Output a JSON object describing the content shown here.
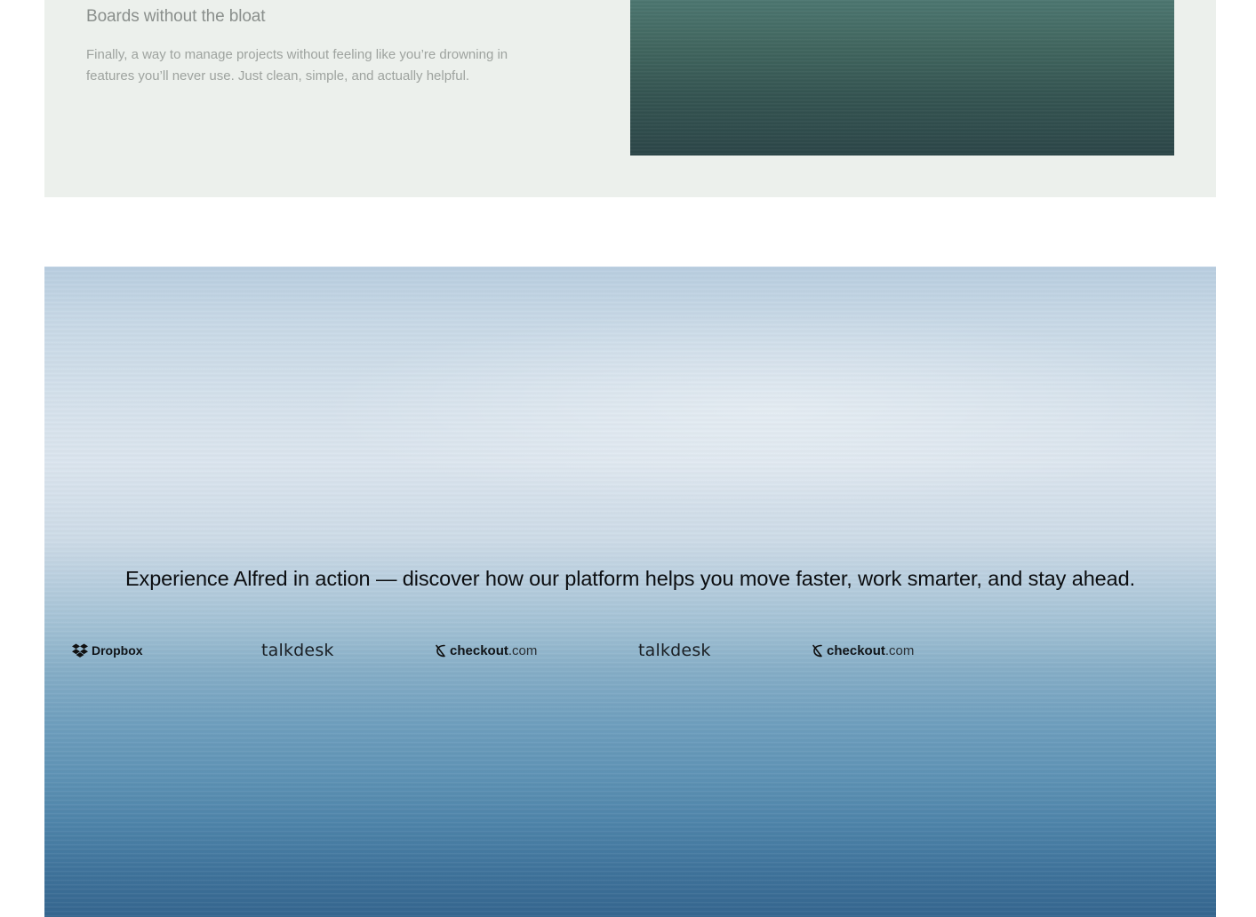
{
  "feature": {
    "title": "Boards without the bloat",
    "description": "Finally, a way to manage projects without feeling like you’re drowning in features you’ll never use. Just clean, simple, and actually helpful."
  },
  "showcase": {
    "headline": "Experience Alfred in action — discover how our platform helps you move faster, work smarter, and stay ahead.",
    "logos": [
      {
        "name": "Dropbox",
        "icon": "dropbox-icon"
      },
      {
        "name": "talkdesk"
      },
      {
        "brand": "checkout",
        "suffix": ".com",
        "icon": "checkout-icon"
      },
      {
        "name": "talkdesk"
      },
      {
        "brand": "checkout",
        "suffix": ".com",
        "icon": "checkout-icon"
      }
    ]
  },
  "colors": {
    "card_background": "#ecf0ec",
    "media_gradient_top": "#4c7670",
    "media_gradient_bottom": "#2c4648",
    "showcase_top": "#b9cee0",
    "showcase_bottom": "#35668f",
    "headline_text": "#0b0d10"
  }
}
